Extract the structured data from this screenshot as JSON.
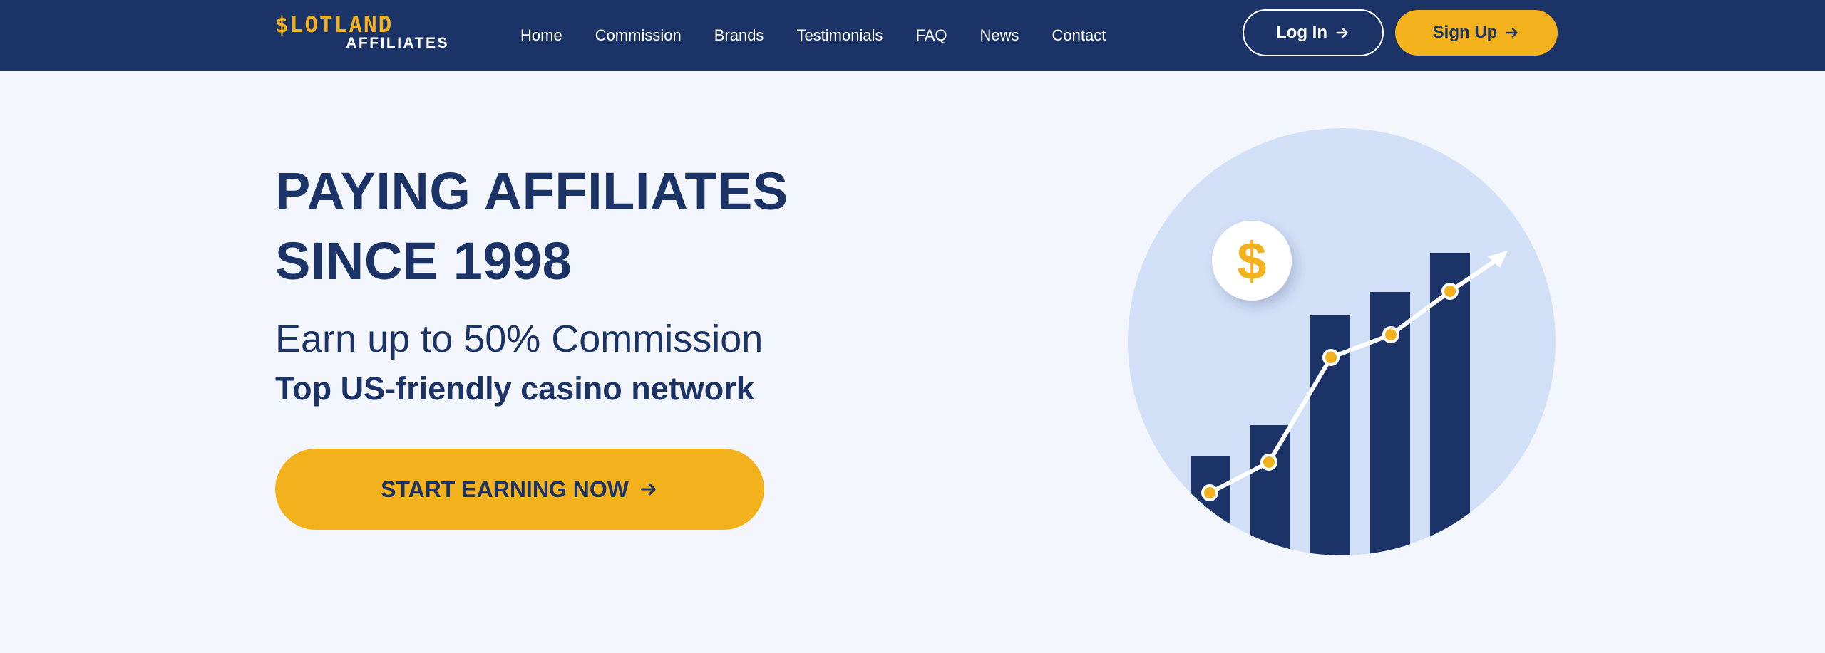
{
  "header": {
    "logo_main": "$LOTLAND",
    "logo_sub": "AFFILIATES",
    "nav": [
      {
        "label": "Home"
      },
      {
        "label": "Commission"
      },
      {
        "label": "Brands"
      },
      {
        "label": "Testimonials"
      },
      {
        "label": "FAQ"
      },
      {
        "label": "News"
      },
      {
        "label": "Contact"
      }
    ],
    "login_label": "Log In",
    "signup_label": "Sign Up"
  },
  "hero": {
    "headline_line1": "PAYING AFFILIATES",
    "headline_line2": "SINCE 1998",
    "subheadline": "Earn up to 50% Commission",
    "tagline": "Top US-friendly casino network",
    "cta_label": "START EARNING NOW"
  },
  "illustration": {
    "coin_symbol": "$",
    "icon": "growth-chart-illustration"
  },
  "colors": {
    "navy": "#1b3366",
    "gold": "#f3b21b",
    "page_bg": "#f3f7fd",
    "circle_bg": "#d2e0f7",
    "white": "#ffffff"
  }
}
